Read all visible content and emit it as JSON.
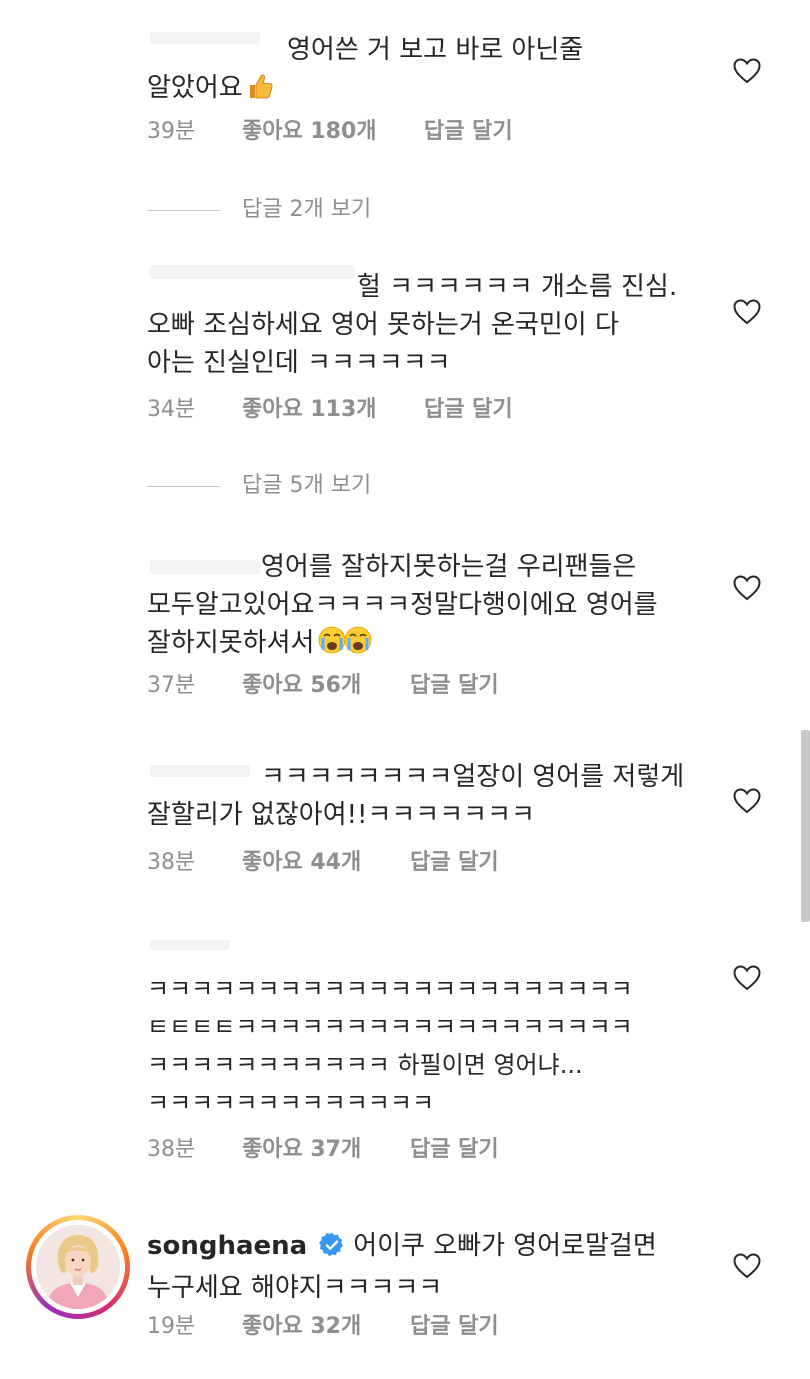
{
  "comments": [
    {
      "user": "",
      "text": "영어쓴 거 보고 바로 아닌줄\n알았어요",
      "emoji": "thumbs-up-emoji",
      "time": "39분",
      "likes": "좋아요 180개",
      "reply": "답글 달기",
      "view_replies": "답글 2개 보기"
    },
    {
      "user": "",
      "text": "헐 ㅋㅋㅋㅋㅋㅋ 개소름 진심.\n오빠 조심하세요 영어 못하는거 온국민이 다\n아는 진실인데 ㅋㅋㅋㅋㅋㅋ",
      "time": "34분",
      "likes": "좋아요 113개",
      "reply": "답글 달기",
      "view_replies": "답글 5개 보기"
    },
    {
      "user": "",
      "text": "영어를 잘하지못하는걸 우리팬들은\n모두알고있어요ㅋㅋㅋㅋ정말다행이에요  영어를\n잘하지못하셔서",
      "emoji": "crying-face-emoji",
      "time": "37분",
      "likes": "좋아요 56개",
      "reply": "답글 달기"
    },
    {
      "user": "",
      "text": "ㅋㅋㅋㅋㅋㅋㅋㅋ얼장이 영어를 저렇게\n잘할리가 없잖아여!!ㅋㅋㅋㅋㅋㅋㅋ",
      "time": "38분",
      "likes": "좋아요 44개",
      "reply": "답글 달기"
    },
    {
      "user": "",
      "text": "ㅋㅋㅋㅋㅋㅋㅋㅋㅋㅋㅋㅋㅋㅋㅋㅋㅋㅋㅋㅋㅋㅋ\nㅌㅌㅌㅌㅋㅋㅋㅋㅋㅋㅋㅋㅋㅋㅋㅋㅋㅋㅋㅋㅋㅋ\nㅋㅋㅋㅋㅋㅋㅋㅋㅋㅋㅋ 하필이면 영어냐...\nㅋㅋㅋㅋㅋㅋㅋㅋㅋㅋㅋㅋㅋ",
      "time": "38분",
      "likes": "좋아요 37개",
      "reply": "답글 달기"
    },
    {
      "user": "songhaena",
      "text": "어이쿠 오빠가 영어로말걸면\n누구세요 해야지ㅋㅋㅋㅋㅋ",
      "time": "19분",
      "likes": "좋아요 32개",
      "reply": "답글 달기"
    }
  ],
  "icons": {
    "like": "heart-outline-icon",
    "verified": "verified-badge-icon"
  },
  "colors": {
    "text": "#262626",
    "meta": "#8e8e8e",
    "verified": "#3897f0"
  }
}
